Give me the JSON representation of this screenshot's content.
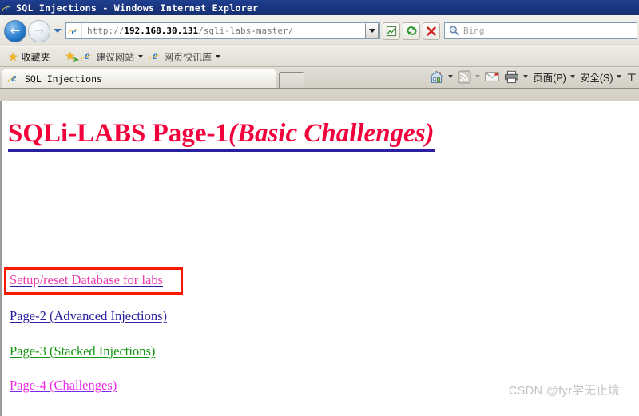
{
  "window": {
    "title": "SQL Injections - Windows Internet Explorer",
    "app_icon": "ie-logo-icon"
  },
  "navigation": {
    "back_label": "←",
    "forward_label": "→",
    "back_icon": "back-arrow-icon",
    "forward_icon": "forward-arrow-icon",
    "recent_pages_icon": "chevron-down-icon"
  },
  "address": {
    "icon": "ie-logo-icon",
    "scheme": "http://",
    "host": "192.168.30.131",
    "path": "/sqli-labs-master/",
    "full_url": "http://192.168.30.131/sqli-labs-master/",
    "dropdown_icon": "chevron-down-icon"
  },
  "toolbar_buttons": [
    {
      "name": "compatibility-view-button",
      "icon": "compatibility-view-icon"
    },
    {
      "name": "refresh-button",
      "icon": "refresh-icon"
    },
    {
      "name": "stop-button",
      "icon": "stop-x-icon"
    }
  ],
  "search": {
    "placeholder": "Bing",
    "icon": "search-magnifier-icon"
  },
  "favorites_bar": {
    "favorites_label": "收藏夹",
    "favorites_icon": "star-icon",
    "add_to_favorites_icon": "star-add-icon",
    "items": [
      {
        "label": "建议网站",
        "icon": "ie-logo-icon",
        "caret": "chevron-down-icon"
      },
      {
        "label": "网页快讯库",
        "icon": "ie-logo-icon",
        "caret": "chevron-down-icon"
      }
    ]
  },
  "tabs": {
    "active": {
      "label": "SQL Injections",
      "icon": "ie-logo-icon"
    },
    "new_tab_label": ""
  },
  "command_bar": {
    "items": [
      {
        "name": "home-button",
        "icon": "home-icon",
        "label": "",
        "caret": true
      },
      {
        "name": "feeds-button",
        "icon": "rss-feed-icon",
        "label": "",
        "caret": true,
        "caret_dim": true
      },
      {
        "name": "mail-button",
        "icon": "mail-icon",
        "label": "",
        "caret": false
      },
      {
        "name": "print-button",
        "icon": "printer-icon",
        "label": "",
        "caret": true
      },
      {
        "name": "page-menu",
        "icon": "",
        "label": "页面(P)",
        "caret": true
      },
      {
        "name": "safety-menu",
        "icon": "",
        "label": "安全(S)",
        "caret": true
      },
      {
        "name": "tools-menu",
        "icon": "",
        "label": "工",
        "caret": false
      }
    ]
  },
  "page": {
    "heading_main": "SQLi-LABS Page-1",
    "heading_italic": "(Basic Challenges)",
    "links": [
      {
        "text": "Setup/reset Database for labs",
        "color": "#ef3cb0",
        "highlighted": true
      },
      {
        "text": "Page-2 (Advanced Injections)",
        "color": "#2a1f9e",
        "highlighted": false
      },
      {
        "text": "Page-3 (Stacked Injections)",
        "color": "#149614",
        "highlighted": false
      },
      {
        "text": "Page-4 (Challenges)",
        "color": "#ef2ce8",
        "highlighted": false
      }
    ],
    "heading_color": "#f3003c",
    "heading_underline_color": "#2a1f9e",
    "annotation_box_color": "#fb1800",
    "watermark": "CSDN @fyr学无止境"
  }
}
